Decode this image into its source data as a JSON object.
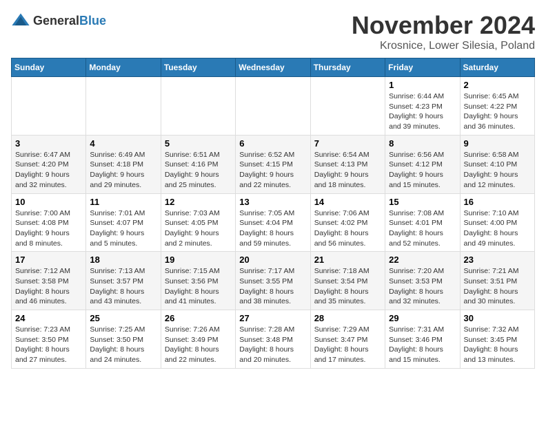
{
  "logo": {
    "general": "General",
    "blue": "Blue"
  },
  "title": "November 2024",
  "location": "Krosnice, Lower Silesia, Poland",
  "days_of_week": [
    "Sunday",
    "Monday",
    "Tuesday",
    "Wednesday",
    "Thursday",
    "Friday",
    "Saturday"
  ],
  "weeks": [
    [
      {
        "day": "",
        "info": ""
      },
      {
        "day": "",
        "info": ""
      },
      {
        "day": "",
        "info": ""
      },
      {
        "day": "",
        "info": ""
      },
      {
        "day": "",
        "info": ""
      },
      {
        "day": "1",
        "info": "Sunrise: 6:44 AM\nSunset: 4:23 PM\nDaylight: 9 hours and 39 minutes."
      },
      {
        "day": "2",
        "info": "Sunrise: 6:45 AM\nSunset: 4:22 PM\nDaylight: 9 hours and 36 minutes."
      }
    ],
    [
      {
        "day": "3",
        "info": "Sunrise: 6:47 AM\nSunset: 4:20 PM\nDaylight: 9 hours and 32 minutes."
      },
      {
        "day": "4",
        "info": "Sunrise: 6:49 AM\nSunset: 4:18 PM\nDaylight: 9 hours and 29 minutes."
      },
      {
        "day": "5",
        "info": "Sunrise: 6:51 AM\nSunset: 4:16 PM\nDaylight: 9 hours and 25 minutes."
      },
      {
        "day": "6",
        "info": "Sunrise: 6:52 AM\nSunset: 4:15 PM\nDaylight: 9 hours and 22 minutes."
      },
      {
        "day": "7",
        "info": "Sunrise: 6:54 AM\nSunset: 4:13 PM\nDaylight: 9 hours and 18 minutes."
      },
      {
        "day": "8",
        "info": "Sunrise: 6:56 AM\nSunset: 4:12 PM\nDaylight: 9 hours and 15 minutes."
      },
      {
        "day": "9",
        "info": "Sunrise: 6:58 AM\nSunset: 4:10 PM\nDaylight: 9 hours and 12 minutes."
      }
    ],
    [
      {
        "day": "10",
        "info": "Sunrise: 7:00 AM\nSunset: 4:08 PM\nDaylight: 9 hours and 8 minutes."
      },
      {
        "day": "11",
        "info": "Sunrise: 7:01 AM\nSunset: 4:07 PM\nDaylight: 9 hours and 5 minutes."
      },
      {
        "day": "12",
        "info": "Sunrise: 7:03 AM\nSunset: 4:05 PM\nDaylight: 9 hours and 2 minutes."
      },
      {
        "day": "13",
        "info": "Sunrise: 7:05 AM\nSunset: 4:04 PM\nDaylight: 8 hours and 59 minutes."
      },
      {
        "day": "14",
        "info": "Sunrise: 7:06 AM\nSunset: 4:02 PM\nDaylight: 8 hours and 56 minutes."
      },
      {
        "day": "15",
        "info": "Sunrise: 7:08 AM\nSunset: 4:01 PM\nDaylight: 8 hours and 52 minutes."
      },
      {
        "day": "16",
        "info": "Sunrise: 7:10 AM\nSunset: 4:00 PM\nDaylight: 8 hours and 49 minutes."
      }
    ],
    [
      {
        "day": "17",
        "info": "Sunrise: 7:12 AM\nSunset: 3:58 PM\nDaylight: 8 hours and 46 minutes."
      },
      {
        "day": "18",
        "info": "Sunrise: 7:13 AM\nSunset: 3:57 PM\nDaylight: 8 hours and 43 minutes."
      },
      {
        "day": "19",
        "info": "Sunrise: 7:15 AM\nSunset: 3:56 PM\nDaylight: 8 hours and 41 minutes."
      },
      {
        "day": "20",
        "info": "Sunrise: 7:17 AM\nSunset: 3:55 PM\nDaylight: 8 hours and 38 minutes."
      },
      {
        "day": "21",
        "info": "Sunrise: 7:18 AM\nSunset: 3:54 PM\nDaylight: 8 hours and 35 minutes."
      },
      {
        "day": "22",
        "info": "Sunrise: 7:20 AM\nSunset: 3:53 PM\nDaylight: 8 hours and 32 minutes."
      },
      {
        "day": "23",
        "info": "Sunrise: 7:21 AM\nSunset: 3:51 PM\nDaylight: 8 hours and 30 minutes."
      }
    ],
    [
      {
        "day": "24",
        "info": "Sunrise: 7:23 AM\nSunset: 3:50 PM\nDaylight: 8 hours and 27 minutes."
      },
      {
        "day": "25",
        "info": "Sunrise: 7:25 AM\nSunset: 3:50 PM\nDaylight: 8 hours and 24 minutes."
      },
      {
        "day": "26",
        "info": "Sunrise: 7:26 AM\nSunset: 3:49 PM\nDaylight: 8 hours and 22 minutes."
      },
      {
        "day": "27",
        "info": "Sunrise: 7:28 AM\nSunset: 3:48 PM\nDaylight: 8 hours and 20 minutes."
      },
      {
        "day": "28",
        "info": "Sunrise: 7:29 AM\nSunset: 3:47 PM\nDaylight: 8 hours and 17 minutes."
      },
      {
        "day": "29",
        "info": "Sunrise: 7:31 AM\nSunset: 3:46 PM\nDaylight: 8 hours and 15 minutes."
      },
      {
        "day": "30",
        "info": "Sunrise: 7:32 AM\nSunset: 3:45 PM\nDaylight: 8 hours and 13 minutes."
      }
    ]
  ]
}
